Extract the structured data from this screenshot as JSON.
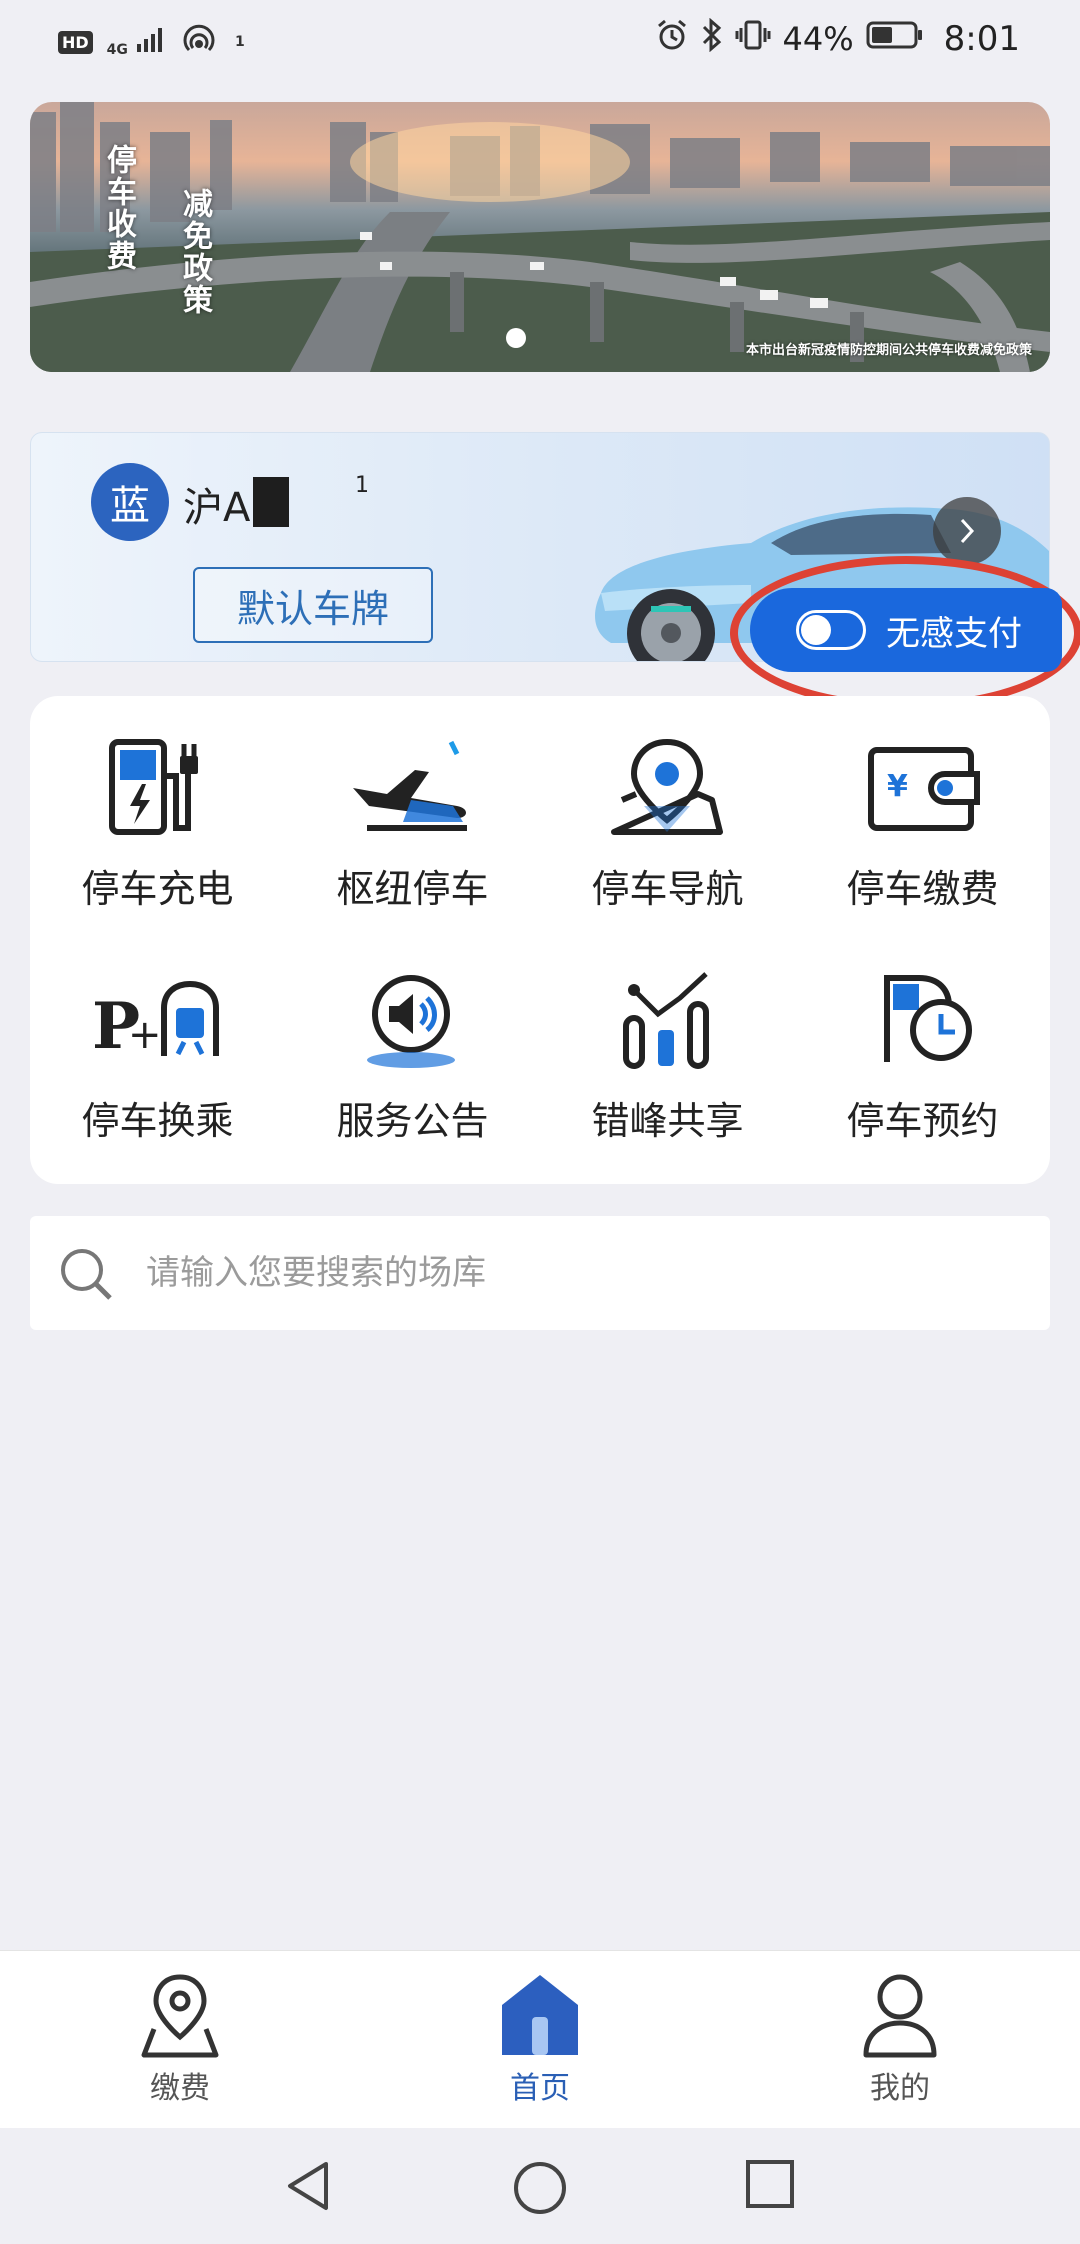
{
  "status_bar": {
    "hd": "HD",
    "network": "4G",
    "hotspot_count": "1",
    "battery_percent": "44%",
    "time": "8:01"
  },
  "banner": {
    "title_left": "停车收费",
    "title_right": "减免政策",
    "caption": "本市出台新冠疫情防控期间公共停车收费减免政策"
  },
  "vehicle": {
    "plate_color": "蓝",
    "plate_prefix": "沪A",
    "plate_suffix": "1",
    "default_plate_label": "默认车牌",
    "seamless_pay_label": "无感支付",
    "seamless_pay_enabled": false
  },
  "services": [
    {
      "label": "停车充电",
      "icon": "charging-station-icon"
    },
    {
      "label": "枢纽停车",
      "icon": "airplane-icon"
    },
    {
      "label": "停车导航",
      "icon": "map-pin-icon"
    },
    {
      "label": "停车缴费",
      "icon": "wallet-icon"
    },
    {
      "label": "停车换乘",
      "icon": "park-and-ride-icon"
    },
    {
      "label": "服务公告",
      "icon": "speaker-icon"
    },
    {
      "label": "错峰共享",
      "icon": "shared-bars-icon"
    },
    {
      "label": "停车预约",
      "icon": "parking-clock-icon"
    }
  ],
  "search": {
    "placeholder": "请输入您要搜索的场库"
  },
  "tabs": [
    {
      "label": "缴费",
      "icon": "location-icon",
      "active": false
    },
    {
      "label": "首页",
      "icon": "home-icon",
      "active": true
    },
    {
      "label": "我的",
      "icon": "profile-icon",
      "active": false
    }
  ],
  "colors": {
    "accent": "#1a68dd",
    "brand_blue": "#2c64bf",
    "highlight_ring": "#dd4234",
    "background": "#efeff4"
  }
}
